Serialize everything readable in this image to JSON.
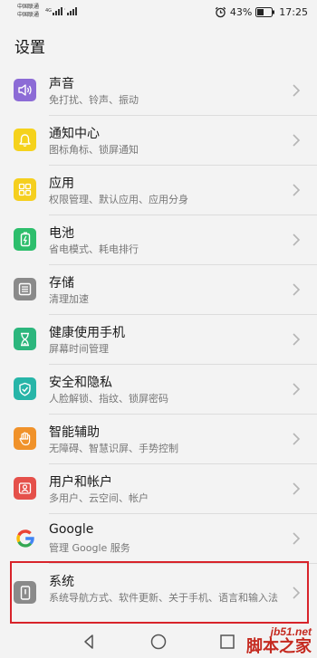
{
  "statusbar": {
    "carrier_1": "中国联通",
    "carrier_2": "中国联通",
    "battery": "43%",
    "time": "17:25"
  },
  "page": {
    "title": "设置"
  },
  "items": [
    {
      "name": "sound",
      "title": "声音",
      "subtitle": "免打扰、铃声、振动",
      "color": "#8c6bd6",
      "icon": "speaker-icon"
    },
    {
      "name": "notifications",
      "title": "通知中心",
      "subtitle": "图标角标、锁屏通知",
      "color": "#f5d21c",
      "icon": "bell-icon"
    },
    {
      "name": "apps",
      "title": "应用",
      "subtitle": "权限管理、默认应用、应用分身",
      "color": "#f5cf1e",
      "icon": "grid-icon"
    },
    {
      "name": "battery",
      "title": "电池",
      "subtitle": "省电模式、耗电排行",
      "color": "#2dbe6c",
      "icon": "battery-icon"
    },
    {
      "name": "storage",
      "title": "存储",
      "subtitle": "清理加速",
      "color": "#8a8a8a",
      "icon": "storage-icon"
    },
    {
      "name": "digital-balance",
      "title": "健康使用手机",
      "subtitle": "屏幕时间管理",
      "color": "#2cb67d",
      "icon": "hourglass-icon"
    },
    {
      "name": "security",
      "title": "安全和隐私",
      "subtitle": "人脸解锁、指纹、锁屏密码",
      "color": "#27b5a8",
      "icon": "shield-icon"
    },
    {
      "name": "accessibility",
      "title": "智能辅助",
      "subtitle": "无障碍、智慧识屏、手势控制",
      "color": "#f0922a",
      "icon": "hand-icon"
    },
    {
      "name": "users",
      "title": "用户和帐户",
      "subtitle": "多用户、云空间、帐户",
      "color": "#e5504a",
      "icon": "user-icon"
    },
    {
      "name": "google",
      "title": "Google",
      "subtitle": "管理 Google 服务",
      "color": "#ffffff",
      "icon": "google-icon"
    },
    {
      "name": "system",
      "title": "系统",
      "subtitle": "系统导航方式、软件更新、关于手机、语言和输入法",
      "color": "#8a8a8a",
      "icon": "phone-icon"
    }
  ],
  "watermark": {
    "url": "jb51.net",
    "name": "脚本之家"
  },
  "colors": {
    "background": "#f3f3f3",
    "highlight_border": "#d8232a",
    "watermark": "#c52a20"
  }
}
